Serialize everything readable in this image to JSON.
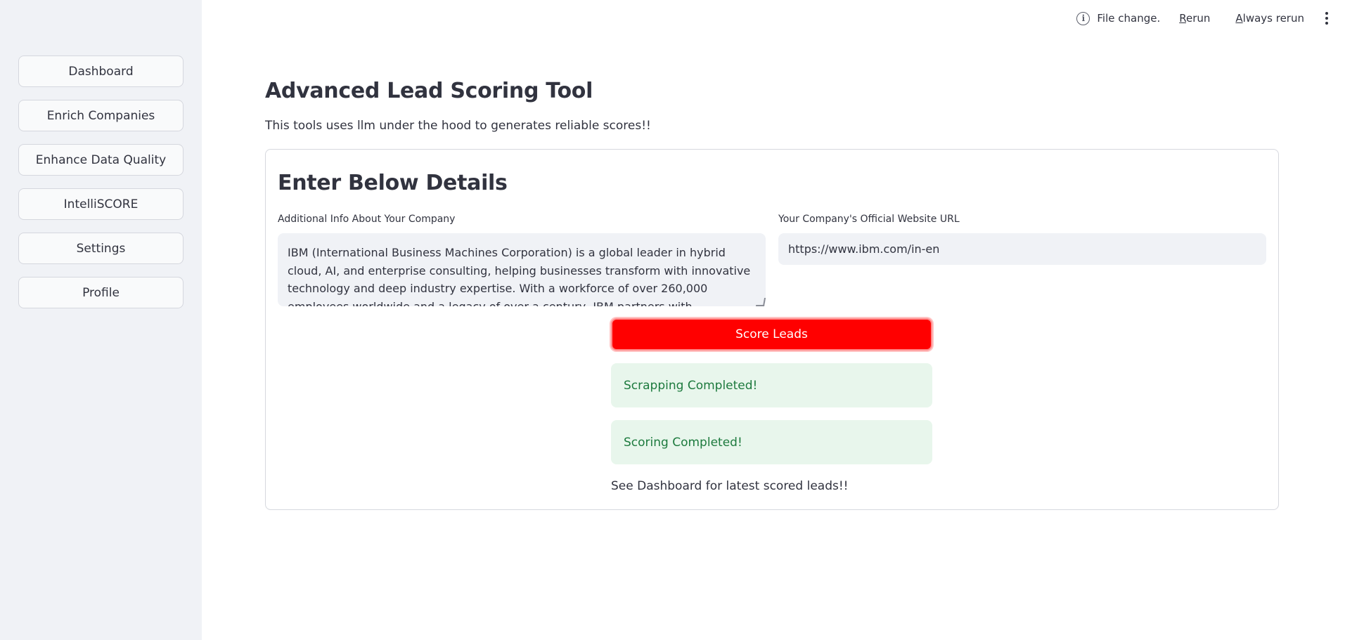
{
  "sidebar": {
    "items": [
      {
        "label": "Dashboard"
      },
      {
        "label": "Enrich Companies"
      },
      {
        "label": "Enhance Data Quality"
      },
      {
        "label": "IntelliSCORE"
      },
      {
        "label": "Settings"
      },
      {
        "label": "Profile"
      }
    ]
  },
  "toolbar": {
    "status_icon": "info-icon",
    "status_text": "File change.",
    "rerun_first": "R",
    "rerun_rest": "erun",
    "always_first": "A",
    "always_rest": "lways rerun",
    "menu_icon": "kebab-menu-icon"
  },
  "main": {
    "title": "Advanced Lead Scoring Tool",
    "subtitle": "This tools uses llm under the hood to generates reliable scores!!",
    "form": {
      "title": "Enter Below Details",
      "company_info": {
        "label": "Additional Info About Your Company",
        "value": "IBM (International Business Machines Corporation) is a global leader in hybrid cloud, AI, and enterprise consulting, helping businesses transform with innovative technology and deep industry expertise. With a workforce of over 260,000 employees worldwide and a legacy of over a century, IBM partners with organizations of all sizes to drive"
      },
      "website": {
        "label": "Your Company's Official Website URL",
        "value": "https://www.ibm.com/in-en"
      },
      "submit_label": "Score Leads",
      "alerts": [
        {
          "text": "Scrapping Completed!"
        },
        {
          "text": "Scoring Completed!"
        }
      ],
      "note": "See Dashboard for latest scored leads!!"
    }
  },
  "colors": {
    "primary_button": "#ff0000",
    "success_bg": "#e8f6ec",
    "success_text": "#1d7a3e",
    "sidebar_bg": "#f0f2f6"
  }
}
